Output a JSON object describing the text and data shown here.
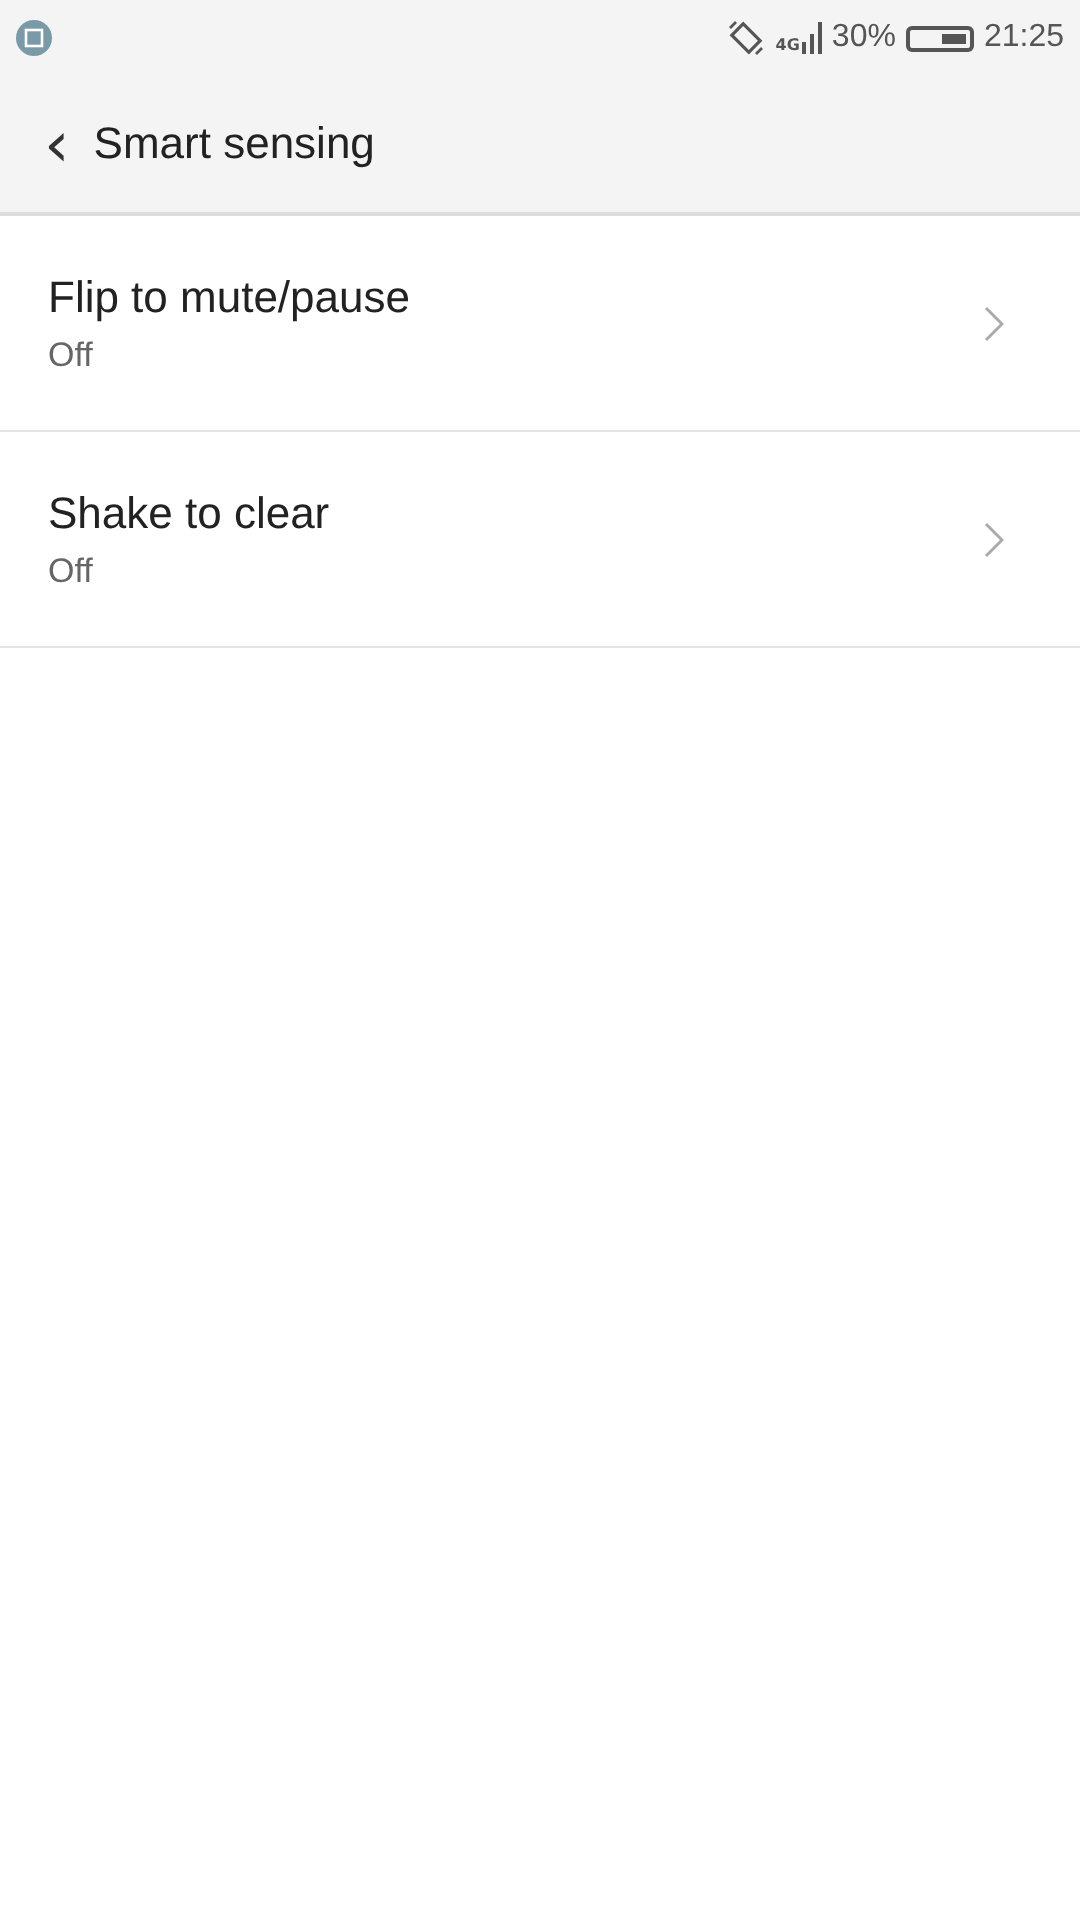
{
  "status_bar": {
    "network": "4G",
    "battery_text": "30%",
    "time": "21:25"
  },
  "header": {
    "back": "‹",
    "title": "Smart sensing"
  },
  "settings": [
    {
      "title": "Flip to mute/pause",
      "value": "Off"
    },
    {
      "title": "Shake to clear",
      "value": "Off"
    }
  ]
}
